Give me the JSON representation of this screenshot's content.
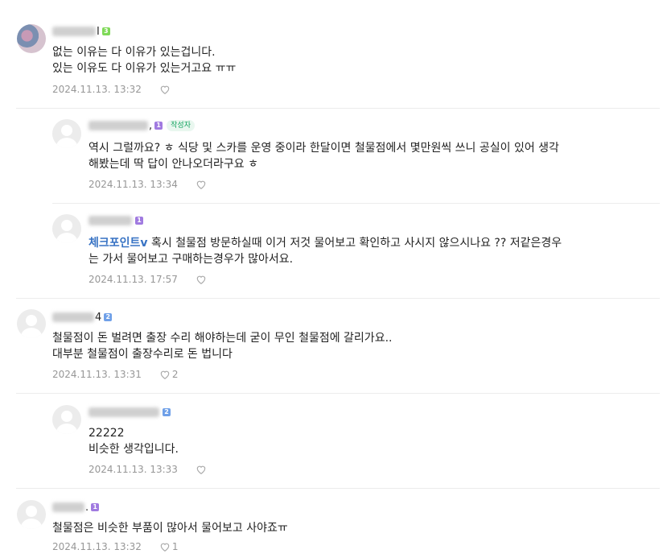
{
  "comments": [
    {
      "nick_tail": "I",
      "level": "3",
      "text": "없는 이유는 다 이유가 있는겁니다.\n있는 이유도 다 이유가 있는거고요 ㅠㅠ",
      "date": "2024.11.13.  13:32",
      "likes": ""
    },
    {
      "nick_tail": ",",
      "level": "1",
      "writer_badge": "작성자",
      "text": "역시 그럴까요? ㅎ 식당 및 스카를 운영 중이라 한달이면 철물점에서 몇만원씩 쓰니 공실이 있어 생각\n해봤는데 딱 답이 안나오더라구요 ㅎ",
      "date": "2024.11.13.  13:34",
      "likes": ""
    },
    {
      "nick_tail": "",
      "level": "1",
      "mention": "체크포인트v",
      "text": " 혹시 철물점 방문하실때 이거 저것 물어보고 확인하고 사시지 않으시나요 ?? 저같은경우\n는 가서 물어보고 구매하는경우가 많아서요.",
      "date": "2024.11.13.  17:57",
      "likes": ""
    },
    {
      "nick_tail": "4",
      "level": "2",
      "text": "철물점이 돈 벌려면 출장 수리 해야하는데 굳이 무인 철물점에 갈리가요..\n대부분 철물점이 출장수리로 돈 법니다",
      "date": "2024.11.13.  13:31",
      "likes": "2"
    },
    {
      "nick_tail": "",
      "level": "2",
      "text": "22222\n비슷한 생각입니다.",
      "date": "2024.11.13.  13:33",
      "likes": ""
    },
    {
      "nick_tail": ".",
      "level": "1",
      "text": "철물점은 비슷한 부품이 많아서 물어보고 사야죠ㅠ",
      "date": "2024.11.13.  13:32",
      "likes": "1"
    }
  ],
  "icons": {
    "heart": "heart-outline-icon",
    "avatar": "default-avatar-icon"
  }
}
